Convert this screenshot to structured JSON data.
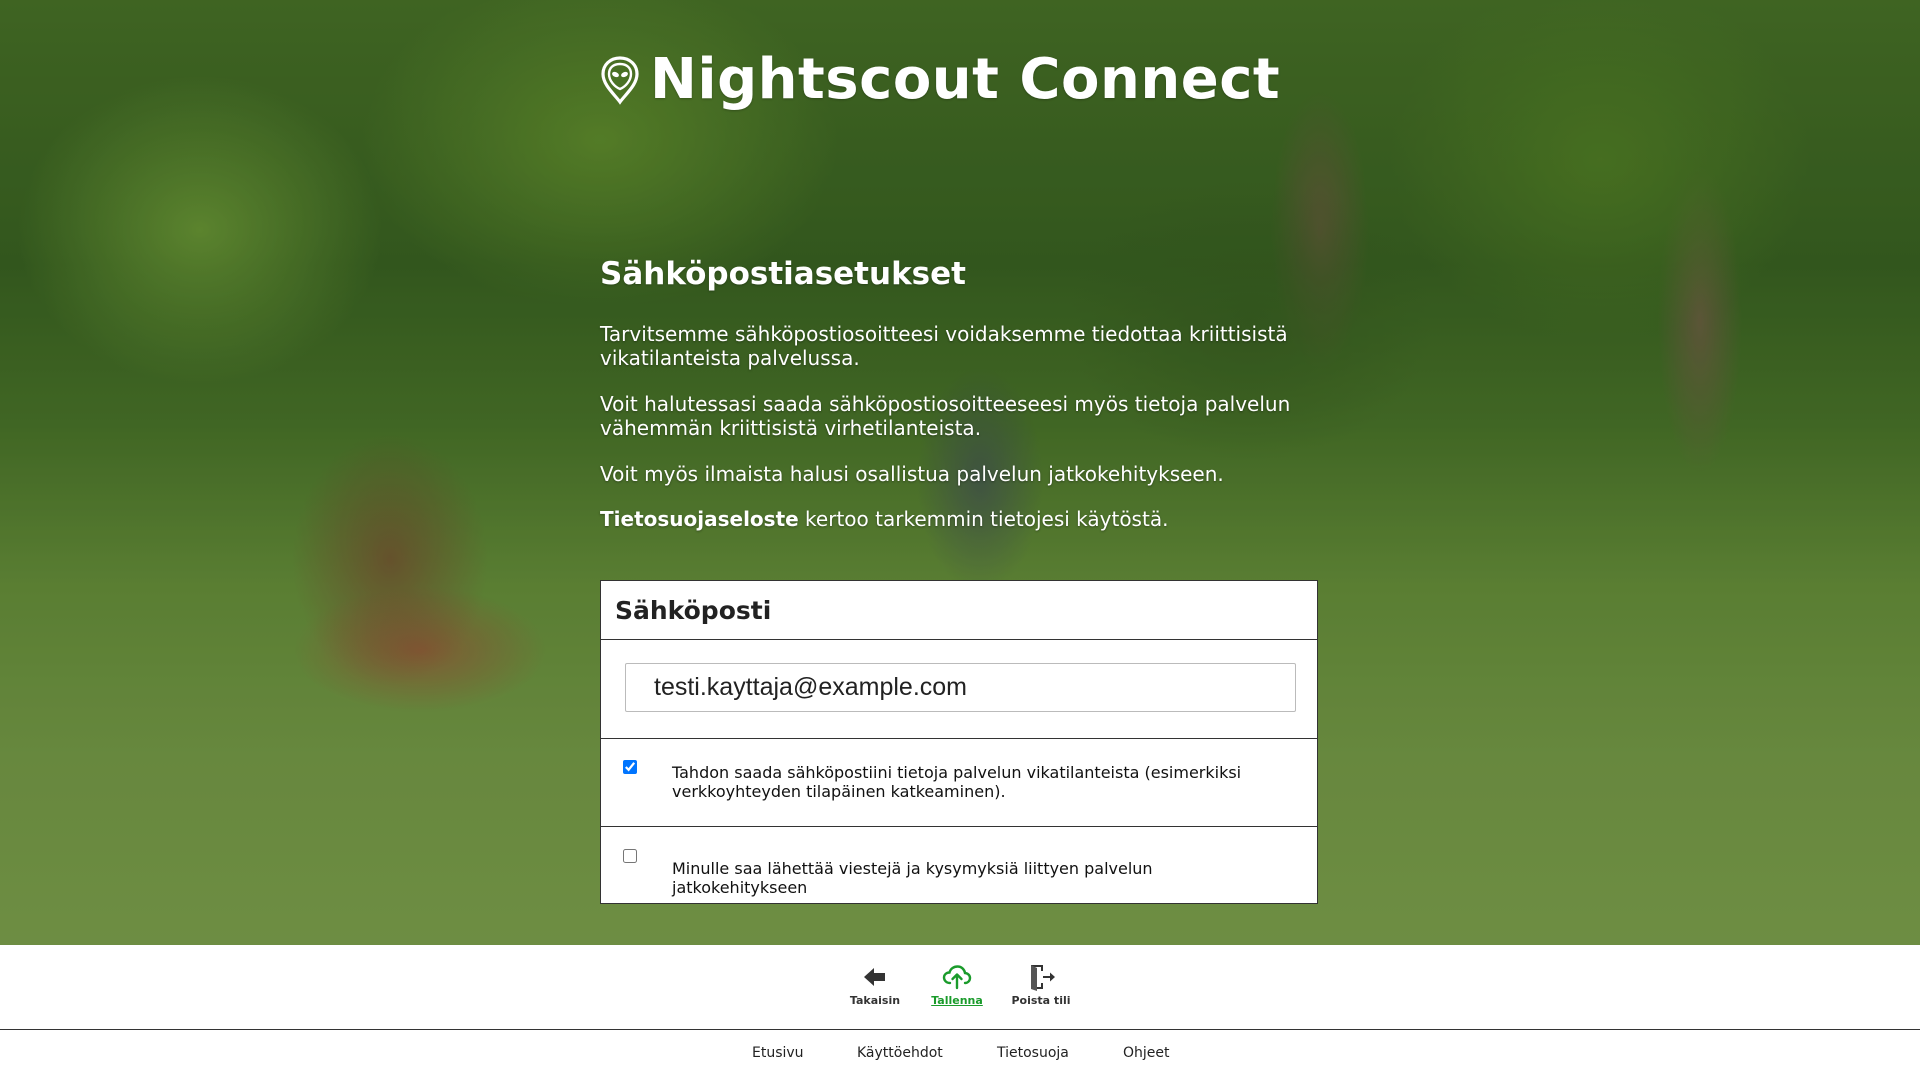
{
  "header": {
    "brand_icon": "alien-map-pin-icon",
    "title": "Nightscout Connect"
  },
  "intro": {
    "heading": "Sähköpostiasetukset",
    "p1": "Tarvitsemme sähköpostiosoitteesi voidaksemme tiedottaa kriittisistä vikatilanteista palvelussa.",
    "p2": "Voit halutessasi saada sähköpostiosoitteeseesi myös tietoja palvelun vähemmän kriittisistä virhetilanteista.",
    "p3": "Voit myös ilmaista halusi osallistua palvelun jatkokehitykseen.",
    "p4_link": "Tietosuojaseloste",
    "p4_rest": " kertoo tarkemmin tietojesi käytöstä."
  },
  "email_card": {
    "title": "Sähköposti",
    "email_value": "testi.kayttaja@example.com",
    "option1": {
      "checked": true,
      "label": "Tahdon saada sähköpostiini tietoja palvelun vikatilanteista (esimerkiksi verkkoyhteyden tilapäinen katkeaminen)."
    },
    "option2": {
      "checked": false,
      "label": "Minulle saa lähettää viestejä ja kysymyksiä liittyen palvelun jatkokehitykseen"
    }
  },
  "toolbar": {
    "back": {
      "label": "Takaisin",
      "icon": "arrow-left-icon"
    },
    "save": {
      "label": "Tallenna",
      "icon": "cloud-upload-icon",
      "color": "#1a9b2b"
    },
    "delete": {
      "label": "Poista tili",
      "icon": "exit-door-icon"
    }
  },
  "footer": {
    "links": [
      "Etusivu",
      "Käyttöehdot",
      "Tietosuoja",
      "Ohjeet"
    ]
  }
}
